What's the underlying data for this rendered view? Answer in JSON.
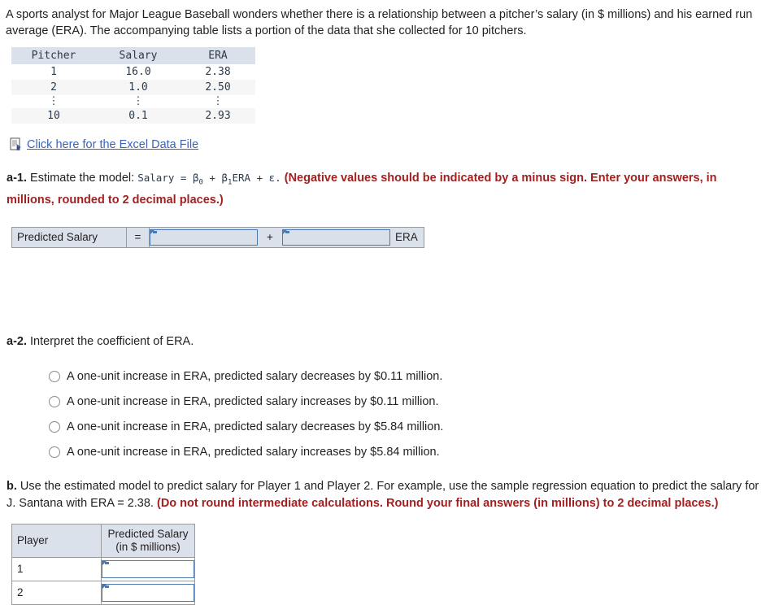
{
  "intro": {
    "text": "A sports analyst for Major League Baseball wonders whether there is a relationship between a pitcher’s salary (in $ millions) and his earned run average (ERA). The accompanying table lists a portion of the data that she collected for 10 pitchers."
  },
  "data_table": {
    "headers": [
      "Pitcher",
      "Salary",
      "ERA"
    ],
    "rows": [
      [
        "1",
        "16.0",
        "2.38"
      ],
      [
        "2",
        "1.0",
        "2.50"
      ],
      [
        "⋮",
        "⋮",
        "⋮"
      ],
      [
        "10",
        "0.1",
        "2.93"
      ]
    ]
  },
  "excel": {
    "icon": "document-pen-icon",
    "link_text": "Click here for the Excel Data File"
  },
  "q_a1": {
    "label": "a-1.",
    "text_before": "Estimate the model:",
    "equation_plain": "Salary = β₀ + β₁ERA + ε.",
    "eq_salary": "Salary",
    "eq_equals": "=",
    "eq_b0": "β",
    "eq_b0_sub": "0",
    "eq_plus1": "+",
    "eq_b1": "β",
    "eq_b1_sub": "1",
    "eq_era": "ERA",
    "eq_plus2": "+",
    "eq_eps": "ε.",
    "emphasis": "(Negative values should be indicated by a minus sign. Enter your answers, in millions, rounded to 2 decimal places.)"
  },
  "answer_row": {
    "label": "Predicted Salary",
    "equals": "=",
    "intercept_value": "",
    "intercept_placeholder": "",
    "plus": "+",
    "slope_value": "",
    "slope_placeholder": "",
    "era_label": "ERA"
  },
  "q_a2": {
    "label": "a-2.",
    "text": "Interpret the coefficient of ERA.",
    "options": [
      "A one-unit increase in ERA, predicted salary decreases by $0.11 million.",
      "A one-unit increase in ERA, predicted salary increases by $0.11 million.",
      "A one-unit increase in ERA, predicted salary decreases by $5.84 million.",
      "A one-unit increase in ERA, predicted salary increases by $5.84 million."
    ],
    "selected_index": null
  },
  "q_b": {
    "label": "b.",
    "text": "Use the estimated model to predict salary for Player 1 and Player 2. For example, use the sample regression equation to predict the salary for J. Santana with ERA = 2.38.",
    "emphasis": "(Do not round intermediate calculations. Round your final answers (in millions) to 2 decimal places.)"
  },
  "pred_table": {
    "header_player": "Player",
    "header_predicted_line1": "Predicted Salary",
    "header_predicted_line2": "(in $ millions)",
    "rows": [
      {
        "player": "1",
        "value": "",
        "placeholder": ""
      },
      {
        "player": "2",
        "value": "",
        "placeholder": ""
      }
    ]
  },
  "colors": {
    "header_bg": "#dbe1ea",
    "alt_row_bg": "#f6f6f6",
    "link_blue": "#3c63b4",
    "emphasis_red": "#a32021",
    "input_border_blue": "#4a7ab0",
    "text": "#231f20",
    "mono_text": "#2d3a4a"
  }
}
